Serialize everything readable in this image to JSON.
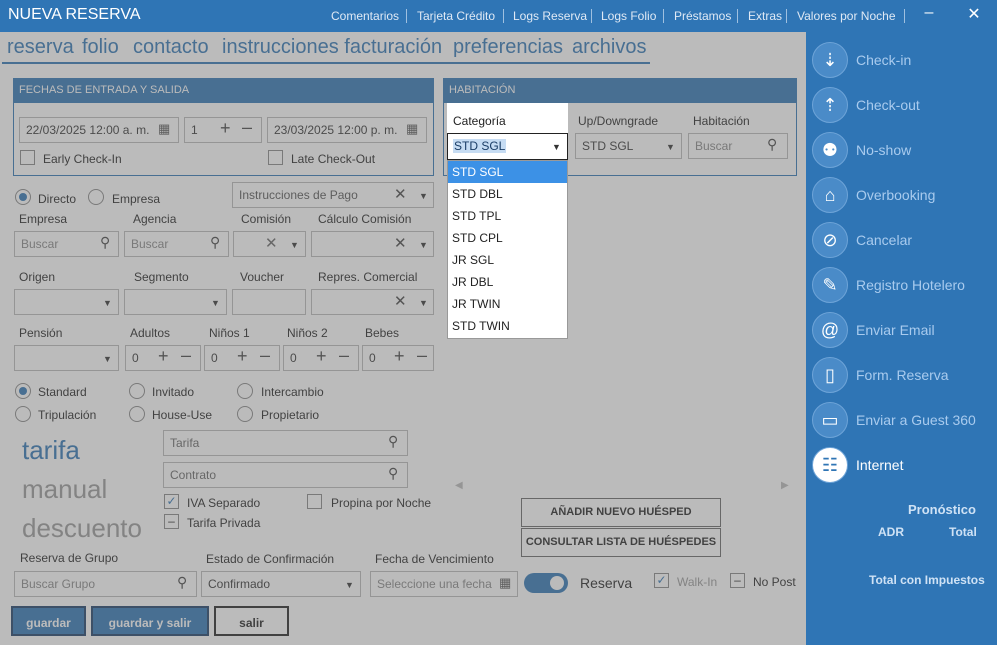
{
  "window": {
    "title": "NUEVA RESERVA",
    "menu": [
      "Comentarios",
      "Tarjeta Crédito",
      "Logs Reserva",
      "Logs Folio",
      "Préstamos",
      "Extras",
      "Valores por Noche"
    ]
  },
  "tabs": [
    "reserva",
    "folio",
    "contacto",
    "instrucciones facturación",
    "preferencias",
    "archivos"
  ],
  "fechas": {
    "header": "FECHAS DE ENTRADA Y SALIDA",
    "entrada": "22/03/2025 12:00 a. m.",
    "noches": "1",
    "salida": "23/03/2025 12:00 p. m.",
    "early_label": "Early Check-In",
    "late_label": "Late Check-Out"
  },
  "habitacion": {
    "header": "HABITACIÓN",
    "categoria_label": "Categoría",
    "categoria_value": "STD SGL",
    "updown_label": "Up/Downgrade",
    "updown_value": "STD SGL",
    "habitacion_label": "Habitación",
    "habitacion_placeholder": "Buscar"
  },
  "categoria_options": [
    "STD SGL",
    "STD DBL",
    "STD TPL",
    "STD CPL",
    "JR SGL",
    "JR DBL",
    "JR TWIN",
    "STD TWIN"
  ],
  "form": {
    "directo": "Directo",
    "empresa_radio": "Empresa",
    "instrucciones": "Instrucciones de Pago",
    "empresa_label": "Empresa",
    "agencia_label": "Agencia",
    "comision_label": "Comisión",
    "calculo_label": "Cálculo Comisión",
    "buscar": "Buscar",
    "origen_label": "Origen",
    "segmento_label": "Segmento",
    "voucher_label": "Voucher",
    "repres_label": "Repres. Comercial",
    "pension_label": "Pensión",
    "adultos_label": "Adultos",
    "ninos1_label": "Niños 1",
    "ninos2_label": "Niños 2",
    "bebes_label": "Bebes",
    "adultos": "0",
    "ninos1": "0",
    "ninos2": "0",
    "bebes": "0",
    "standard": "Standard",
    "invitado": "Invitado",
    "intercambio": "Intercambio",
    "tripulacion": "Tripulación",
    "house_use": "House-Use",
    "propietario": "Propietario",
    "tarifa_big": "tarifa",
    "manual_big": "manual",
    "descuento_big": "descuento",
    "tarifa_ph": "Tarifa",
    "contrato_ph": "Contrato",
    "iva": "IVA Separado",
    "propina": "Propina por Noche",
    "tarifa_privada": "Tarifa Privada",
    "anadir": "AÑADIR NUEVO HUÉSPED",
    "consultar": "CONSULTAR LISTA DE HUÉSPEDES",
    "grupo_label": "Reserva de Grupo",
    "grupo_ph": "Buscar Grupo",
    "estado_label": "Estado de Confirmación",
    "estado_value": "Confirmado",
    "vencimiento_label": "Fecha de Vencimiento",
    "vencimiento_ph": "Seleccione una fecha",
    "reserva_toggle": "Reserva",
    "walkin": "Walk-In",
    "nopost": "No Post"
  },
  "buttons": {
    "guardar": "guardar",
    "guardar_salir": "guardar y salir",
    "salir": "salir"
  },
  "sidebar": {
    "actions": [
      "Check-in",
      "Check-out",
      "No-show",
      "Overbooking",
      "Cancelar",
      "Registro Hotelero",
      "Enviar Email",
      "Form. Reserva",
      "Enviar a Guest 360",
      "Internet"
    ],
    "pronostico": "Pronóstico",
    "adr": "ADR",
    "total": "Total",
    "total_impuestos": "Total con Impuestos"
  },
  "colors": {
    "accent": "#2f75b5",
    "highlight": "#3c91e6"
  }
}
